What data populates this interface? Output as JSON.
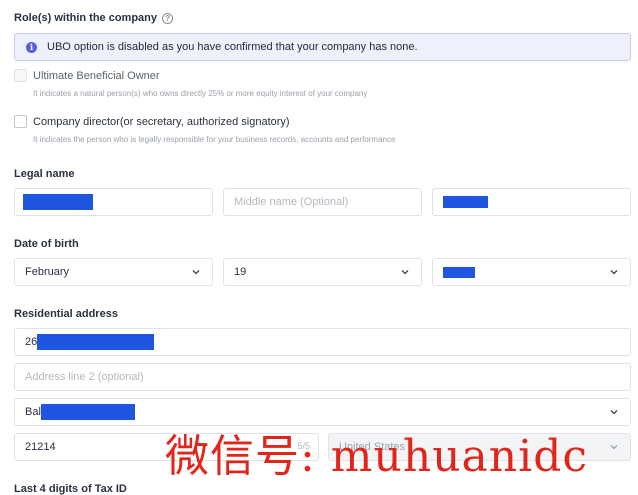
{
  "roles": {
    "label": "Role(s) within the company",
    "help_icon": "?",
    "notice": {
      "icon": "i",
      "text": "UBO option is disabled as you have confirmed that your company has none."
    },
    "options": [
      {
        "label": "Ultimate Beneficial Owner",
        "description": "It indicates a natural person(s) who owns directly 25% or more equity interest of your company",
        "checked": false,
        "disabled": true
      },
      {
        "label": "Company director(or secretary, authorized signatory)",
        "description": "It indicates the person who is legally responsible for your business records, accounts and performance",
        "checked": false,
        "disabled": false
      }
    ]
  },
  "legal_name": {
    "label": "Legal name",
    "middle_placeholder": "Middle name (Optional)"
  },
  "dob": {
    "label": "Date of birth",
    "month": "February",
    "day": "19"
  },
  "address": {
    "label": "Residential address",
    "line1_prefix": "26",
    "line2_placeholder": "Address line 2 (optional)",
    "city_prefix": "Bal",
    "zip": "21214",
    "zip_counter": "5/5",
    "country": "United States"
  },
  "tax": {
    "label": "Last 4 digits of Tax ID"
  },
  "watermark": "微信号: muhuanidc",
  "colors": {
    "accent": "#5b5fd6",
    "redaction": "#1f56e0",
    "watermark": "#e1251b"
  }
}
